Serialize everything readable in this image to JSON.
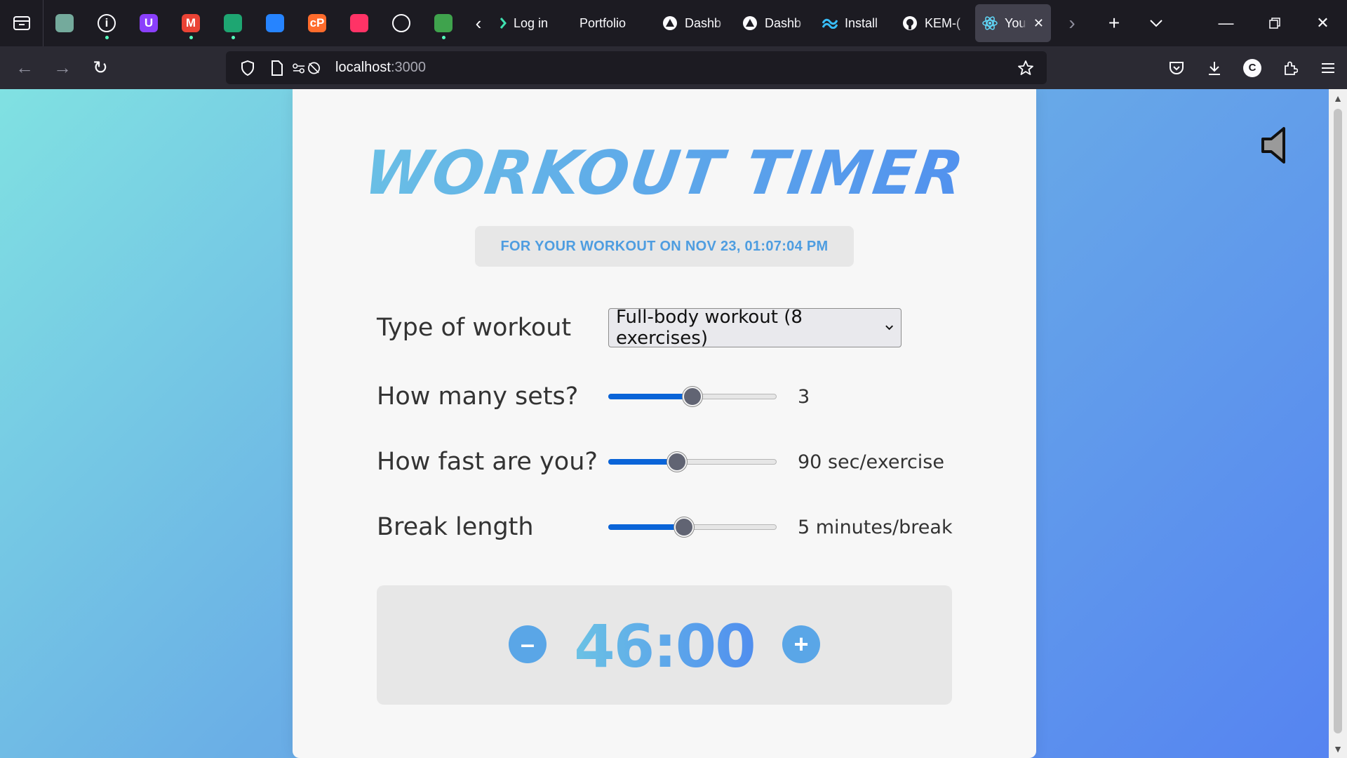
{
  "browser": {
    "pinned_tabs": [
      {
        "name": "chatgpt-pinned-tab",
        "color": "#74aa9c",
        "glyph": "",
        "dot": false
      },
      {
        "name": "info-pinned-tab",
        "color": "#1c1b22",
        "glyph": "i",
        "dot": true
      },
      {
        "name": "proton-pinned-tab",
        "color": "#8a3ffc",
        "glyph": "U",
        "dot": false
      },
      {
        "name": "gmail-pinned-tab",
        "color": "#ea4335",
        "glyph": "M",
        "dot": true
      },
      {
        "name": "activity-pinned-tab",
        "color": "#1ea672",
        "glyph": "",
        "dot": true
      },
      {
        "name": "jira-pinned-tab",
        "color": "#2684ff",
        "glyph": "",
        "dot": false
      },
      {
        "name": "cpanel-pinned-tab",
        "color": "#ff6c2c",
        "glyph": "cP",
        "dot": false
      },
      {
        "name": "unsplash-pinned-tab",
        "color": "#ff3366",
        "glyph": "",
        "dot": false
      },
      {
        "name": "globe-pinned-tab",
        "color": "#1c1b22",
        "glyph": "",
        "dot": false
      },
      {
        "name": "earth-pinned-tab",
        "color": "#3fa34d",
        "glyph": "",
        "dot": true
      }
    ],
    "tabs": [
      {
        "label": "Log in",
        "icon": "green-dot-icon",
        "active": false
      },
      {
        "label": "Portfolio",
        "icon": "",
        "active": false
      },
      {
        "label": "Dashb",
        "icon": "triangle-icon",
        "active": false
      },
      {
        "label": "Dashb",
        "icon": "triangle-icon",
        "active": false
      },
      {
        "label": "Install",
        "icon": "tailwind-icon",
        "active": false
      },
      {
        "label": "KEM-(",
        "icon": "github-icon",
        "active": false
      },
      {
        "label": "You",
        "icon": "react-icon",
        "active": true
      }
    ],
    "url": {
      "host": "localhost",
      "port": ":3000"
    }
  },
  "app": {
    "title": "WORKOUT TIMER",
    "subtitle": "FOR YOUR WORKOUT ON NOV 23, 01:07:04 PM",
    "workout_type": {
      "label": "Type of workout",
      "selected": "Full-body workout (8 exercises)"
    },
    "sets": {
      "label": "How many sets?",
      "value": "3",
      "fraction": 0.5
    },
    "speed": {
      "label": "How fast are you?",
      "value": "90 sec/exercise",
      "fraction": 0.41
    },
    "break": {
      "label": "Break length",
      "value": "5 minutes/break",
      "fraction": 0.45
    },
    "timer": {
      "minus": "–",
      "plus": "+",
      "display": "46:00"
    }
  }
}
